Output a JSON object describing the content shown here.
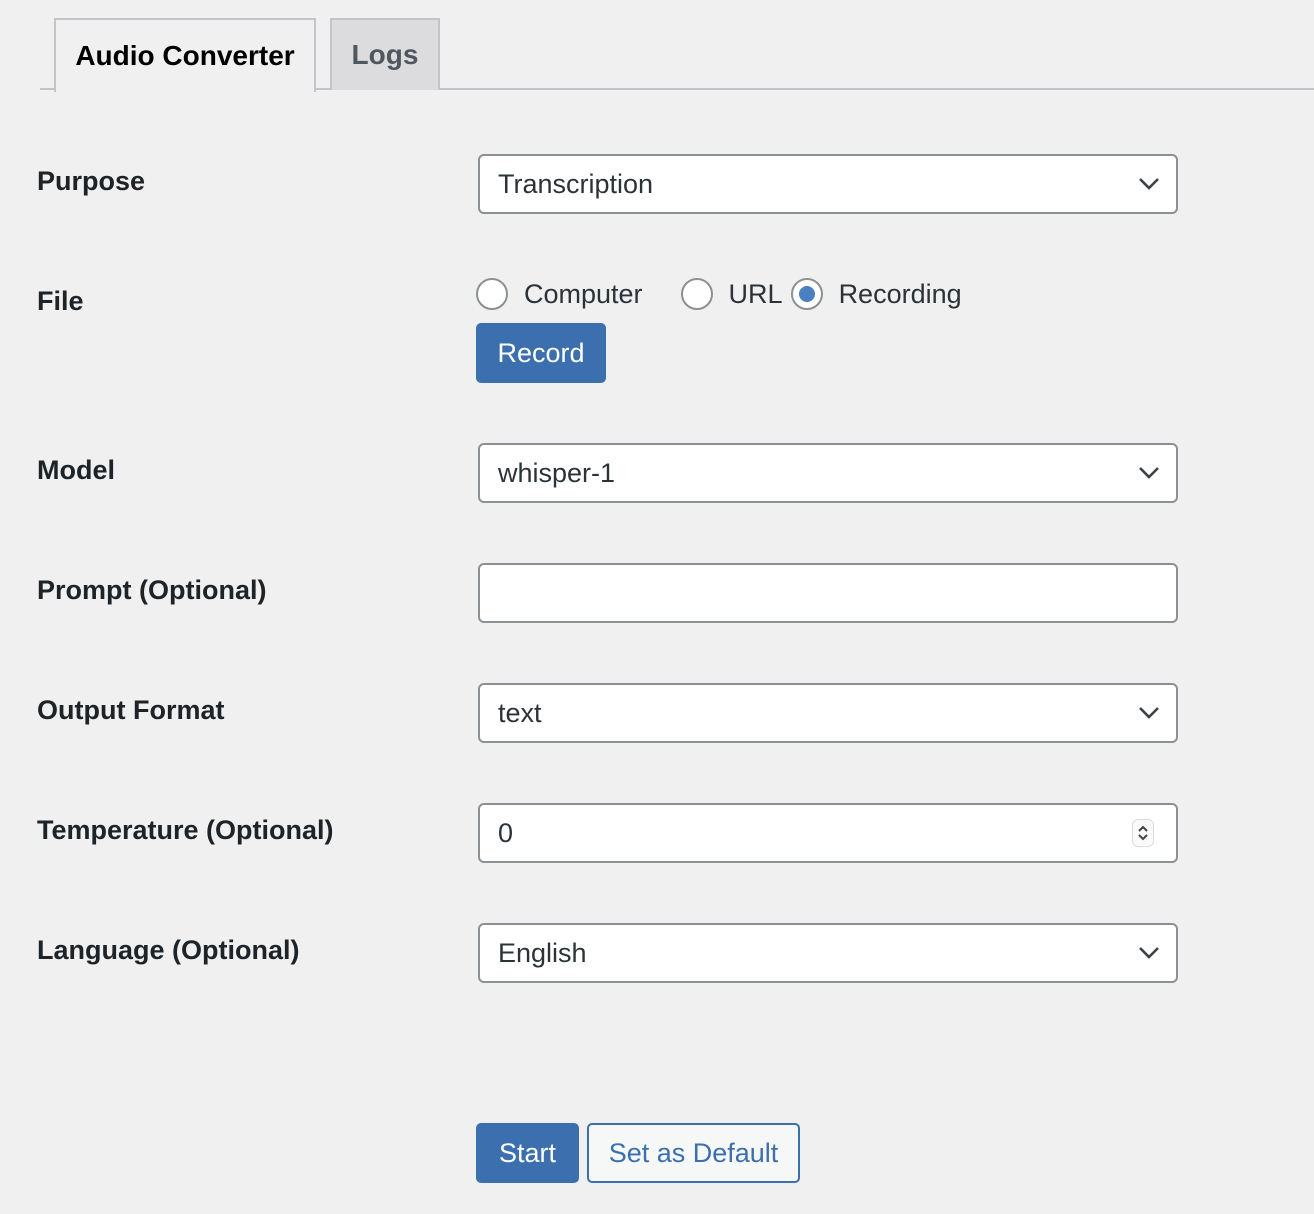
{
  "tabs": [
    {
      "label": "Audio Converter",
      "active": true
    },
    {
      "label": "Logs",
      "active": false
    }
  ],
  "form": {
    "purpose": {
      "label": "Purpose",
      "value": "Transcription"
    },
    "file": {
      "label": "File",
      "options": [
        {
          "label": "Computer",
          "checked": false
        },
        {
          "label": "URL",
          "checked": false
        },
        {
          "label": "Recording",
          "checked": true
        }
      ],
      "record_button": "Record"
    },
    "model": {
      "label": "Model",
      "value": "whisper-1"
    },
    "prompt": {
      "label": "Prompt (Optional)",
      "value": ""
    },
    "output_format": {
      "label": "Output Format",
      "value": "text"
    },
    "temperature": {
      "label": "Temperature (Optional)",
      "value": "0"
    },
    "language": {
      "label": "Language (Optional)",
      "value": "English"
    }
  },
  "actions": {
    "start": "Start",
    "set_default": "Set as Default"
  },
  "colors": {
    "accent": "#3b6fae",
    "radio_checked": "#4a7fc1",
    "background": "#f0f0f1"
  }
}
